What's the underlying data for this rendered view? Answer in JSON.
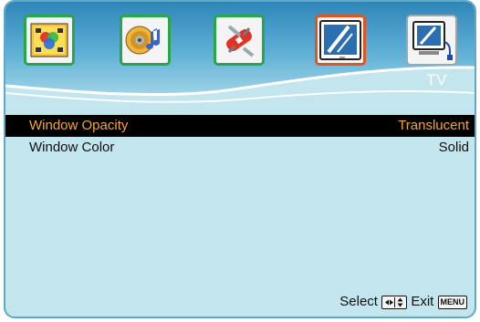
{
  "menu": {
    "category_icons": [
      {
        "icon": "picture-icon",
        "selected": false
      },
      {
        "icon": "audio-icon",
        "selected": false
      },
      {
        "icon": "setup-tools-icon",
        "selected": false
      },
      {
        "icon": "tv-icon",
        "selected": true
      },
      {
        "icon": "pc-monitor-icon",
        "selected": false
      }
    ],
    "section_title": "TV",
    "options": [
      {
        "label": "Window Opacity",
        "value": "Translucent",
        "selected": true
      },
      {
        "label": "Window Color",
        "value": "Solid",
        "selected": false
      }
    ]
  },
  "footer": {
    "select_label": "Select",
    "exit_label": "Exit",
    "menu_key": "MENU",
    "select_keys_icon": "arrow-keys-icon"
  },
  "colors": {
    "background": "#c2e5ee",
    "highlight_bar": "#000000",
    "highlight_text": "#f7a81e",
    "selected_tile_border": "#e2541d",
    "tile_border": "#27a64a"
  }
}
